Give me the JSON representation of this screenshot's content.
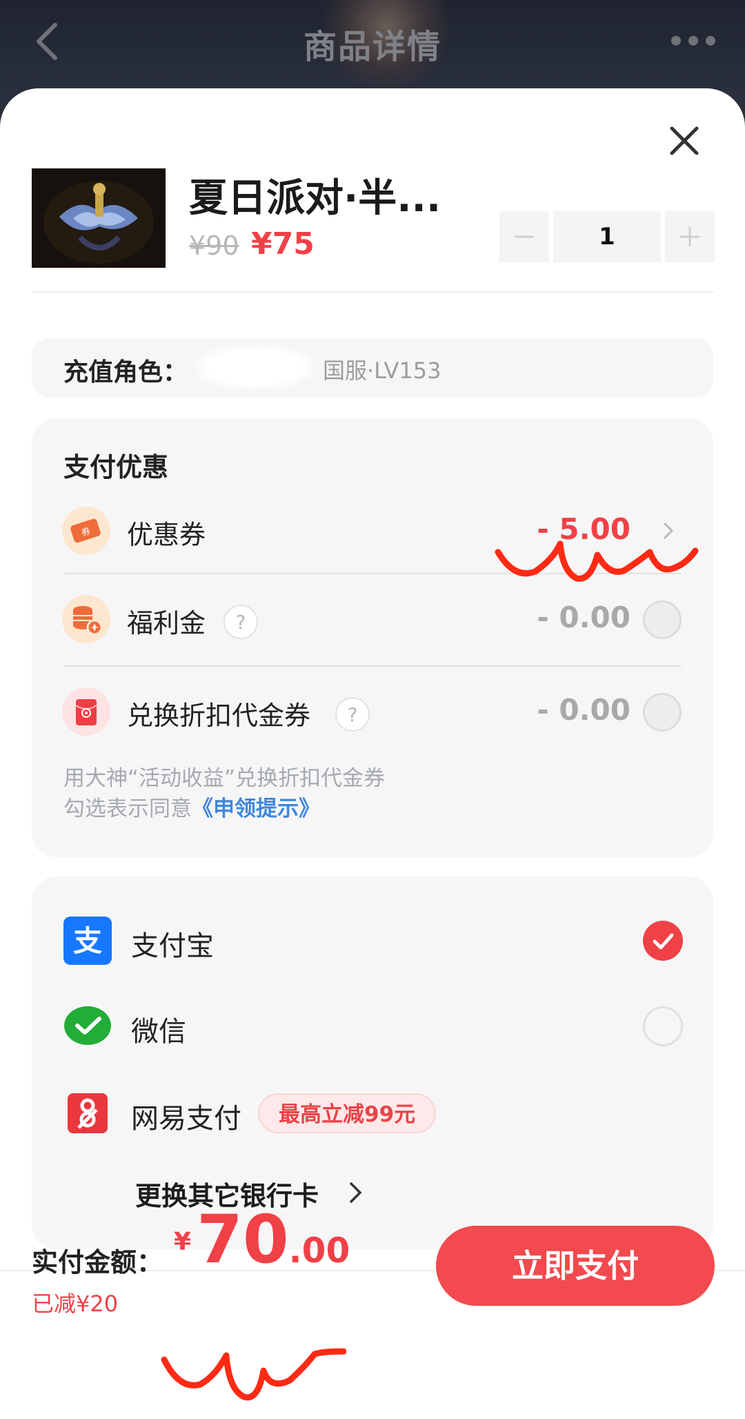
{
  "header": {
    "title": "商品详情",
    "back_icon": "chevron-left-icon",
    "more_icon": "more-dots-icon"
  },
  "product": {
    "name": "夏日派对·半...",
    "original_price": "¥90",
    "price": "¥75",
    "quantity": "1"
  },
  "role": {
    "label": "充值角色：",
    "server": "国服·LV153"
  },
  "discounts": {
    "title": "支付优惠",
    "coupon": {
      "label": "优惠券",
      "amount": "- 5.00",
      "icon": "coupon-ticket-icon"
    },
    "welfare": {
      "label": "福利金",
      "amount": "- 0.00",
      "icon": "coin-stack-icon"
    },
    "voucher": {
      "label": "兑换折扣代金券",
      "amount": "- 0.00",
      "icon": "red-envelope-icon"
    },
    "note_line1": "用大神“活动收益”兑换折扣代金券",
    "note_line2_prefix": "勾选表示同意",
    "note_link": "《申领提示》"
  },
  "payment_methods": [
    {
      "label": "支付宝",
      "icon": "alipay-icon",
      "selected": true
    },
    {
      "label": "微信",
      "icon": "wechat-pay-icon",
      "selected": false
    },
    {
      "label": "网易支付",
      "icon": "netease-pay-icon",
      "badge": "最高立减99元"
    }
  ],
  "change_card_label": "更换其它银行卡",
  "footer": {
    "total_label": "实付金额：",
    "currency": "¥",
    "amount_int": "70",
    "amount_dec": ".00",
    "saved": "已减¥20",
    "pay_button": "立即支付"
  },
  "colors": {
    "accent": "#f04147",
    "link": "#3e86de",
    "alipay": "#1677ff",
    "wechat": "#22ac38",
    "netease": "#e8383d"
  }
}
